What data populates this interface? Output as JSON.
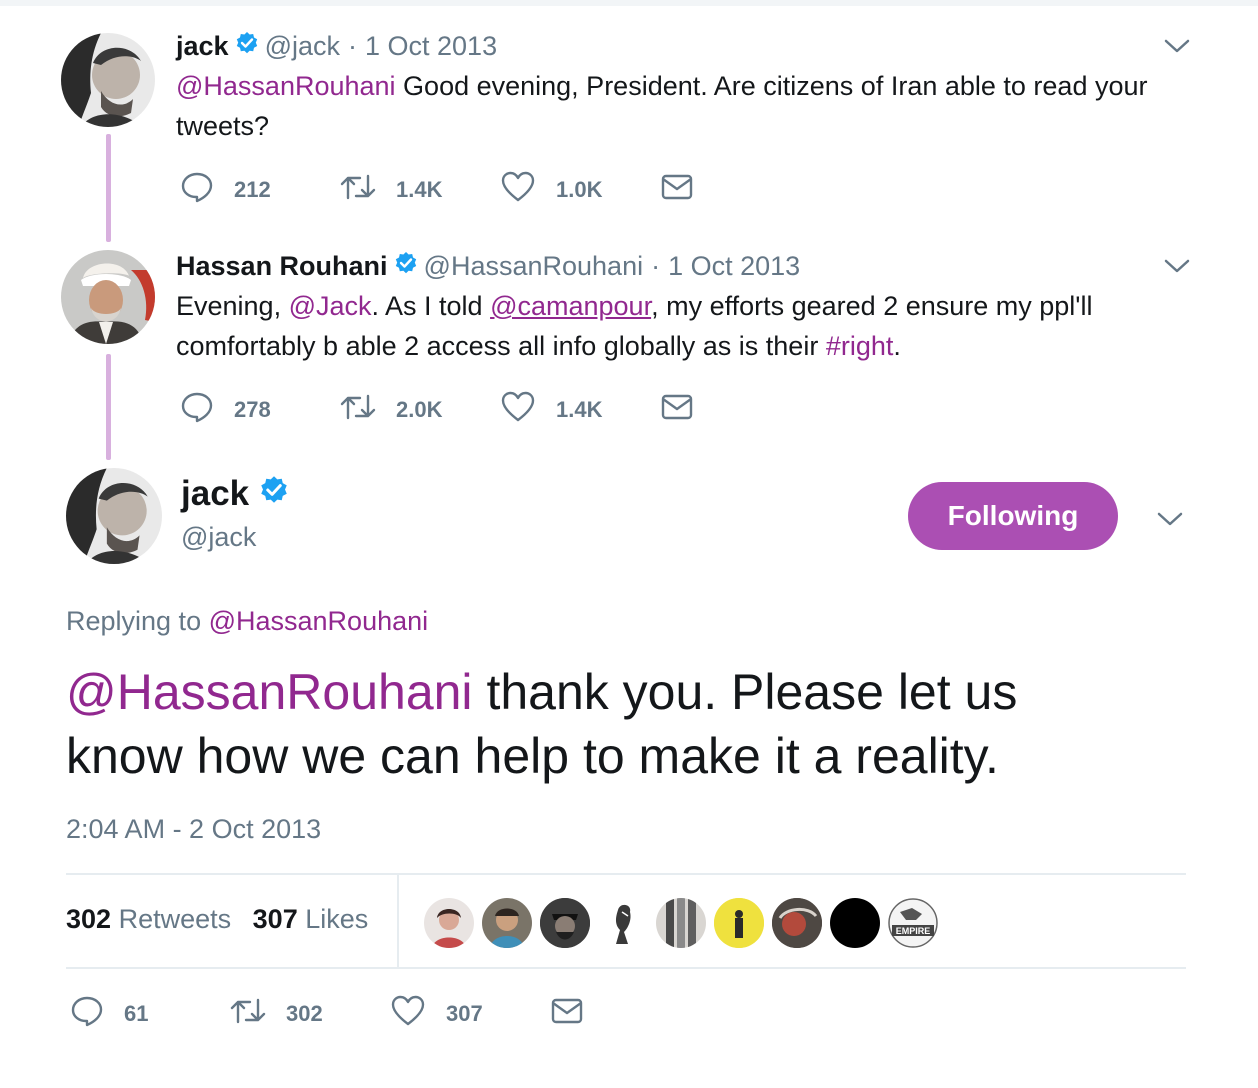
{
  "tweets": [
    {
      "name": "jack",
      "handle": "@jack",
      "separator": "·",
      "date": "1 Oct 2013",
      "mention": "@HassanRouhani",
      "text_line1_rest": " Good evening, President. Are citizens of Iran able to read your",
      "text_line2": "tweets?",
      "replies": "212",
      "retweets": "1.4K",
      "likes": "1.0K"
    },
    {
      "name": "Hassan Rouhani",
      "handle": "@HassanRouhani",
      "separator": "·",
      "date": "1 Oct 2013",
      "t1": "Evening, ",
      "mention1": "@Jack",
      "t2": ". As I told ",
      "mention2": "@camanpour",
      "t3": ", my efforts geared 2 ensure my ppl'll",
      "t4": "comfortably b able 2 access all info globally as is their ",
      "hashtag": "#right",
      "t5": ".",
      "replies": "278",
      "retweets": "2.0K",
      "likes": "1.4K"
    }
  ],
  "main": {
    "name": "jack",
    "handle": "@jack",
    "follow_label": "Following",
    "replying_prefix": "Replying to ",
    "replying_to": "@HassanRouhani",
    "mention": "@HassanRouhani",
    "text_line1_rest": " thank you. Please let us",
    "text_line2": "know how we can help to make it a reality.",
    "timestamp": "2:04 AM - 2 Oct 2013",
    "retweet_count": "302",
    "retweet_label": "Retweets",
    "like_count": "307",
    "like_label": "Likes",
    "replies": "61",
    "retweets": "302",
    "likes": "307",
    "liker_badge_text": "EMPIRE"
  },
  "colors": {
    "link": "#91288f",
    "button": "#ab4fb3",
    "thread_line": "#d8b0de",
    "muted": "#657786",
    "verified": "#1da1f2"
  },
  "icons": [
    "verified-badge-icon",
    "chevron-down-icon",
    "reply-icon",
    "retweet-icon",
    "like-icon",
    "dm-icon"
  ]
}
